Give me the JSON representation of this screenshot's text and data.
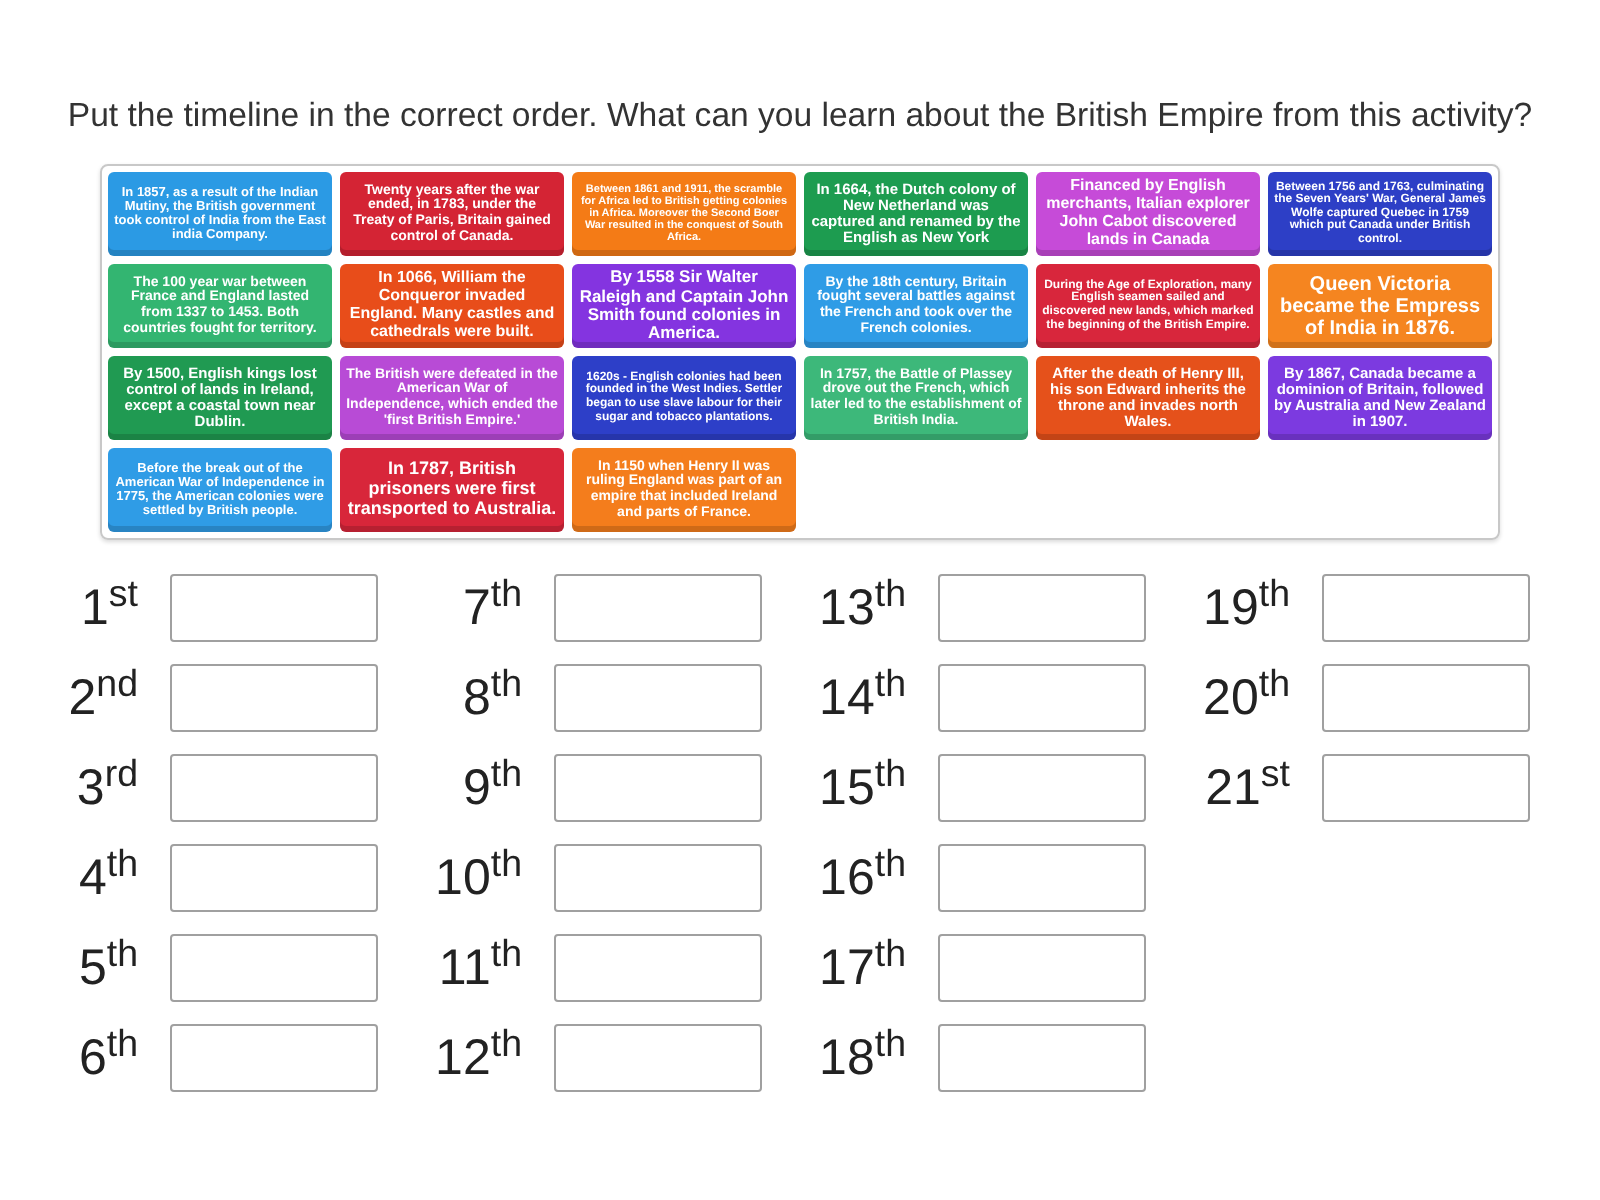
{
  "instruction": "Put the timeline in the correct order. What can you learn about the British Empire from this activity?",
  "cards": [
    {
      "text": "In 1857, as a result of the Indian Mutiny, the British government took control of India from the East india Company.",
      "color": "#2b9ae4"
    },
    {
      "text": "Twenty years after the war ended, in 1783, under the Treaty of Paris, Britain gained control of Canada.",
      "color": "#d42434"
    },
    {
      "text": "Between 1861 and 1911, the scramble for Africa led to British getting colonies in Africa. Moreover the Second Boer War resulted in the conquest of South Africa.",
      "color": "#f47b16"
    },
    {
      "text": "In 1664, the Dutch colony of New Netherland was captured and renamed by the English as New York",
      "color": "#1d9c50"
    },
    {
      "text": "Financed by English merchants, Italian explorer John Cabot discovered lands in Canada",
      "color": "#c64bd8"
    },
    {
      "text": "Between 1756 and 1763, culminating the Seven Years' War, General James Wolfe captured Quebec in 1759 which put Canada under British control.",
      "color": "#2d3fc6"
    },
    {
      "text": "The 100 year war between France and England lasted from 1337 to 1453. Both countries fought for territory.",
      "color": "#33b571"
    },
    {
      "text": "In 1066, William the Conqueror invaded England. Many castles and cathedrals were built.",
      "color": "#e84d1a"
    },
    {
      "text": "By 1558 Sir Walter Raleigh and Captain John Smith found colonies in America.",
      "color": "#8434e0"
    },
    {
      "text": "By the 18th century, Britain fought several battles against the French and took over the French colonies.",
      "color": "#2f9ce6"
    },
    {
      "text": "During the Age of Exploration, many English seamen sailed and discovered new lands, which marked the beginning of the British Empire.",
      "color": "#d8263c"
    },
    {
      "text": "Queen Victoria became the Empress of India in 1876.",
      "color": "#f58520"
    },
    {
      "text": "By 1500, English kings lost control of lands in Ireland, except a coastal town near Dublin.",
      "color": "#209a52"
    },
    {
      "text": "The British were defeated in the American War of Independence, which ended the 'first British Empire.'",
      "color": "#b84bd6"
    },
    {
      "text": "1620s - English colonies had been founded in the West Indies. Settler began to use slave labour for their sugar and tobacco plantations.",
      "color": "#2d3fc8"
    },
    {
      "text": "In 1757, the Battle of Plassey drove out the French, which later led to the establishment of British India.",
      "color": "#3db87a"
    },
    {
      "text": "After the death of Henry III, his son Edward inherits the throne and invades north Wales.",
      "color": "#e5511b"
    },
    {
      "text": "By 1867, Canada became a dominion of Britain, followed by Australia and New Zealand in 1907.",
      "color": "#7c3ae0"
    },
    {
      "text": "Before the break out of the American War of Independence in 1775, the American colonies were settled by British people.",
      "color": "#2f9ce6"
    },
    {
      "text": "In 1787, British prisoners were first transported to Australia.",
      "color": "#d8263a"
    },
    {
      "text": "In 1150 when Henry II was ruling England was part of an empire that included Ireland and parts of France.",
      "color": "#f47d1c"
    }
  ],
  "slots": [
    {
      "label": "1$^{st}$"
    },
    {
      "label": "2$^{nd}$"
    },
    {
      "label": "3$^{rd}$"
    },
    {
      "label": "4$^{th}$"
    },
    {
      "label": "5$^{th}$"
    },
    {
      "label": "6$^{th}$"
    },
    {
      "label": "7$^{th}$"
    },
    {
      "label": "8$^{th}$"
    },
    {
      "label": "9$^{th}$"
    },
    {
      "label": "10$^{th}$"
    },
    {
      "label": "11$^{th}$"
    },
    {
      "label": "12$^{th}$"
    },
    {
      "label": "13$^{th}$"
    },
    {
      "label": "14$^{th}$"
    },
    {
      "label": "15$^{th}$"
    },
    {
      "label": "16$^{th}$"
    },
    {
      "label": "17$^{th}$"
    },
    {
      "label": "18$^{th}$"
    },
    {
      "label": "19$^{th}$"
    },
    {
      "label": "20$^{th}$"
    },
    {
      "label": "21$^{st}$"
    }
  ]
}
